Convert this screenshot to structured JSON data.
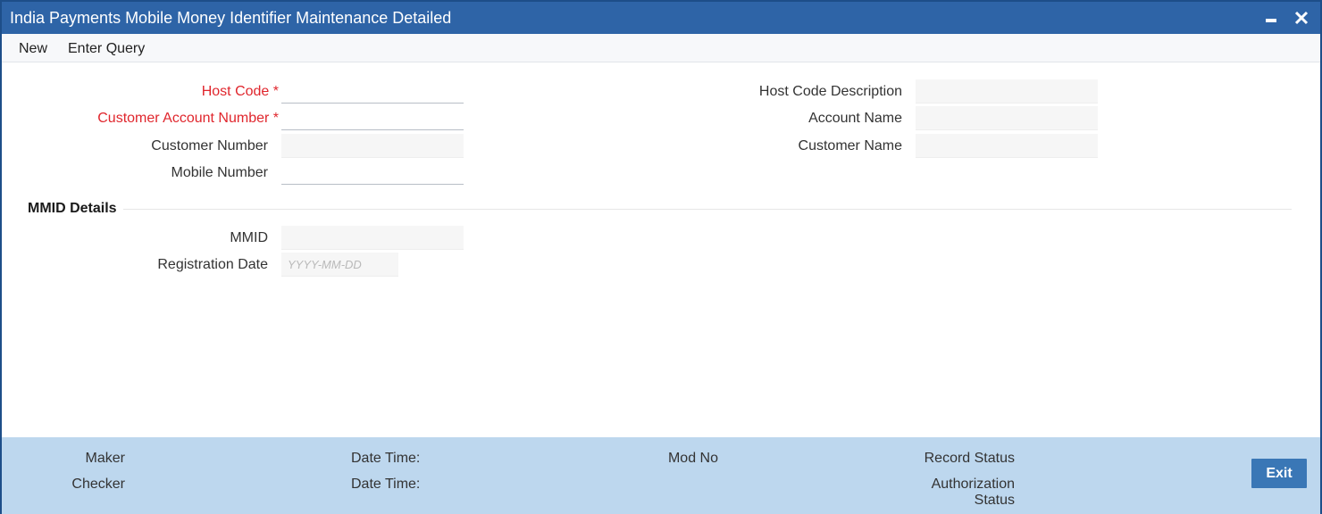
{
  "window": {
    "title": "India Payments Mobile Money Identifier Maintenance Detailed",
    "minimize_icon": "minimize-icon",
    "close_icon": "close-icon"
  },
  "menu": {
    "items": [
      {
        "label": "New"
      },
      {
        "label": "Enter Query"
      }
    ]
  },
  "form": {
    "left": {
      "host_code": {
        "label": "Host Code",
        "required_mark": "*",
        "value": ""
      },
      "customer_account_number": {
        "label": "Customer Account Number",
        "required_mark": "*",
        "value": ""
      },
      "customer_number": {
        "label": "Customer Number",
        "value": ""
      },
      "mobile_number": {
        "label": "Mobile Number",
        "value": ""
      }
    },
    "right": {
      "host_code_description": {
        "label": "Host Code Description",
        "value": ""
      },
      "account_name": {
        "label": "Account Name",
        "value": ""
      },
      "customer_name": {
        "label": "Customer Name",
        "value": ""
      }
    }
  },
  "mmid_section": {
    "title": "MMID Details",
    "mmid": {
      "label": "MMID",
      "value": ""
    },
    "registration_date": {
      "label": "Registration Date",
      "placeholder": "YYYY-MM-DD",
      "value": ""
    }
  },
  "footer": {
    "maker_label": "Maker",
    "checker_label": "Checker",
    "date_time_label_1": "Date Time:",
    "date_time_label_2": "Date Time:",
    "mod_no_label": "Mod No",
    "record_status_label": "Record Status",
    "authorization_status_line1": "Authorization",
    "authorization_status_line2": "Status",
    "exit_label": "Exit"
  },
  "colors": {
    "titlebar": "#2e64a7",
    "required_label": "#e0262d",
    "footer_bg": "#bdd7ee",
    "exit_button": "#3a77b6"
  }
}
